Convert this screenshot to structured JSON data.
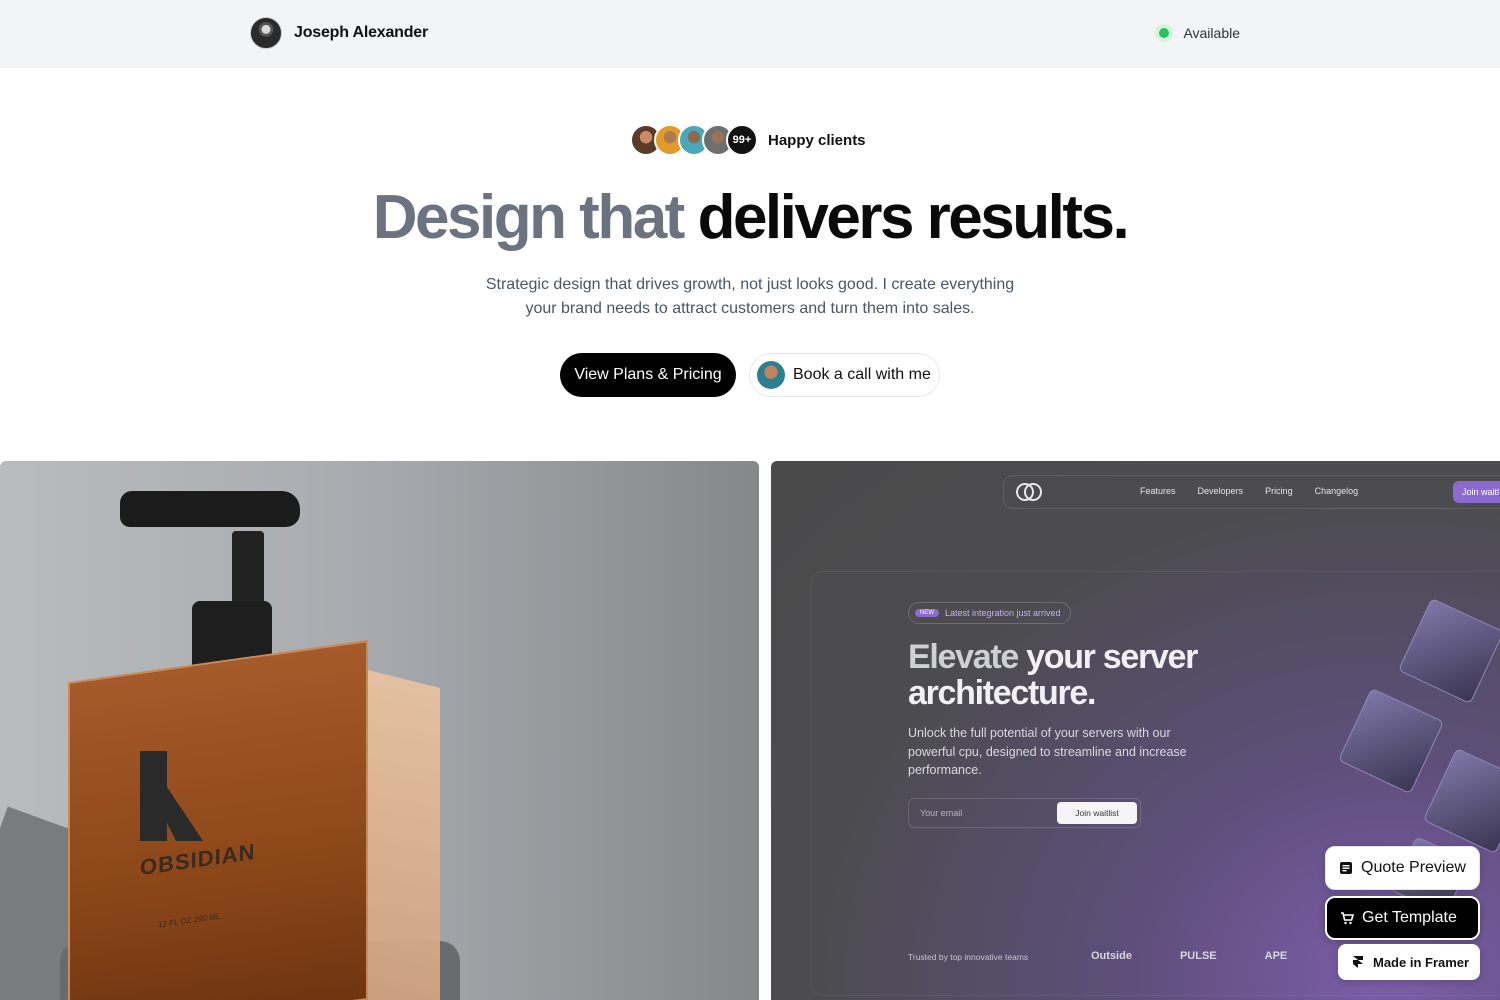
{
  "header": {
    "name": "Joseph Alexander",
    "status": "Available",
    "status_color": "#22c55e"
  },
  "hero": {
    "clients_count": "99+",
    "clients_label": "Happy clients",
    "headline_muted": "Design that",
    "headline_dark": "delivers results.",
    "subtitle_line1": "Strategic design that drives growth, not just looks good. I create everything",
    "subtitle_line2": "your brand needs to attract customers and turn them into sales.",
    "primary_cta": "View Plans & Pricing",
    "secondary_cta": "Book a call with me"
  },
  "showcase_left": {
    "brand": "OBSIDIAN",
    "volume": "12 FL OZ 290 ML"
  },
  "showcase_right": {
    "nav": [
      "Features",
      "Developers",
      "Pricing",
      "Changelog"
    ],
    "join_button": "Join waitl",
    "badge_new": "NEW",
    "badge_text": "Latest integration just arrived",
    "title_fade": "Elevate",
    "title_rest": "your server architecture.",
    "description": "Unlock the full potential of your servers with our powerful cpu, designed to streamline and increase performance.",
    "email_placeholder": "Your email",
    "submit_label": "Join waitlist",
    "trusted_label": "Trusted by top innovative teams",
    "logos": [
      "Outside",
      "PULSE",
      "APE"
    ],
    "accent_color": "#8b6ad1"
  },
  "floating": {
    "quote_label": "Quote Preview",
    "template_label": "Get Template",
    "framer_label": "Made in Framer"
  }
}
